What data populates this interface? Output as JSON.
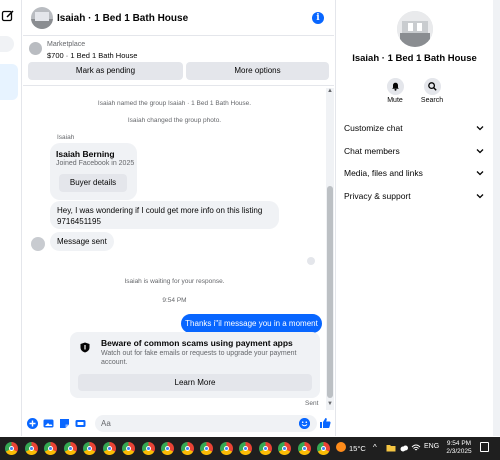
{
  "header": {
    "title": "Isaiah · 1 Bed 1 Bath House"
  },
  "marketplace": {
    "label": "Marketplace",
    "price_line": "$700 · 1 Bed 1 Bath House",
    "pending_label": "Mark as pending",
    "more_label": "More options"
  },
  "thread": {
    "sys_1": "Isaiah named the group Isaiah · 1 Bed 1 Bath House.",
    "sys_2": "Isaiah changed the group photo.",
    "sender": "Isaiah",
    "card_name": "Isaiah Berning",
    "card_sub": "Joined Facebook in 2025",
    "card_button": "Buyer details",
    "message_1": "Hey, I was wondering if I could get more info on this listing 9716451195",
    "message_2": "Message sent",
    "waiting": "Isaiah is waiting for your response.",
    "time": "9:54 PM",
    "outgoing": "Thanks i\"il message you in a moment",
    "notice_title": "Beware of common scams using payment apps",
    "notice_text": "Watch out for fake emails or requests to upgrade your payment account.",
    "notice_button": "Learn More",
    "sent_label": "Sent"
  },
  "composer": {
    "placeholder": "Aa"
  },
  "details": {
    "title": "Isaiah · 1 Bed 1 Bath House",
    "mute_label": "Mute",
    "search_label": "Search",
    "sections": [
      "Customize chat",
      "Chat members",
      "Media, files and links",
      "Privacy & support"
    ]
  },
  "taskbar": {
    "temperature": "15°C",
    "language": "ENG",
    "time": "9:54 PM",
    "date": "2/3/2025"
  },
  "colors": {
    "accent": "#0866ff",
    "bubble_in": "#f0f2f5",
    "button_gray": "#e4e6eb",
    "taskbar": "#1f1f1f"
  }
}
